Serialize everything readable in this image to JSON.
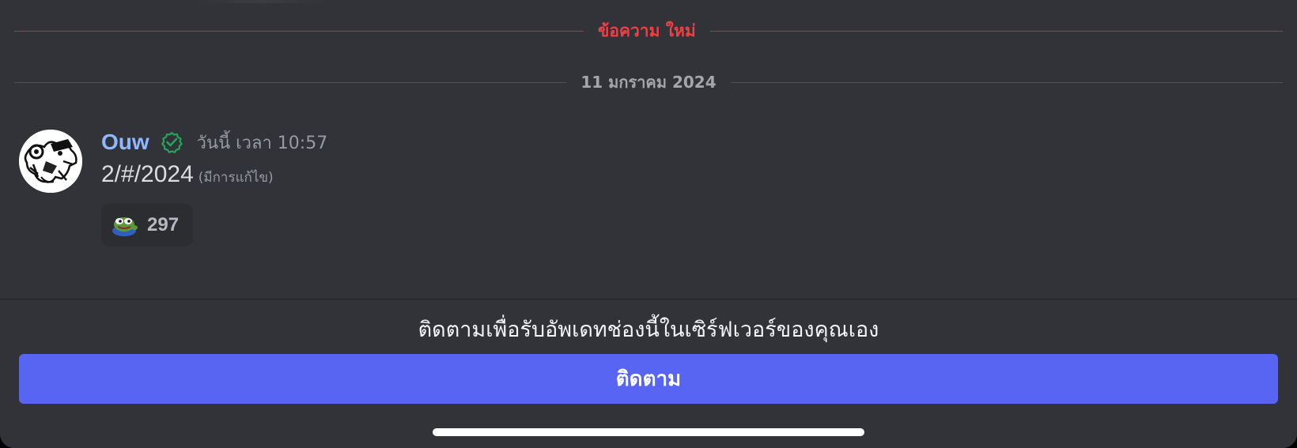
{
  "dividers": {
    "new_messages": "ข้อความ ใหม่",
    "date": "11 มกราคม 2024"
  },
  "message": {
    "author": "Ouw",
    "timestamp": "วันนี้ เวลา 10:57",
    "content": "2/#/2024",
    "edited_label": "(มีการแก้ไข)",
    "avatar_icon": "avatar-image",
    "verified_icon": "verified-check-icon",
    "reaction": {
      "emoji": "pepe-frog-emoji",
      "count": "297"
    }
  },
  "follow_panel": {
    "prompt": "ติดตามเพื่อรับอัพเดทช่องนี้ในเซิร์ฟเวอร์ของคุณเอง",
    "button_label": "ติดตาม"
  },
  "colors": {
    "background": "#313338",
    "accent": "#5865f2",
    "new_divider": "#f23f43",
    "author": "#8fb8ff",
    "verified": "#23a55a"
  }
}
